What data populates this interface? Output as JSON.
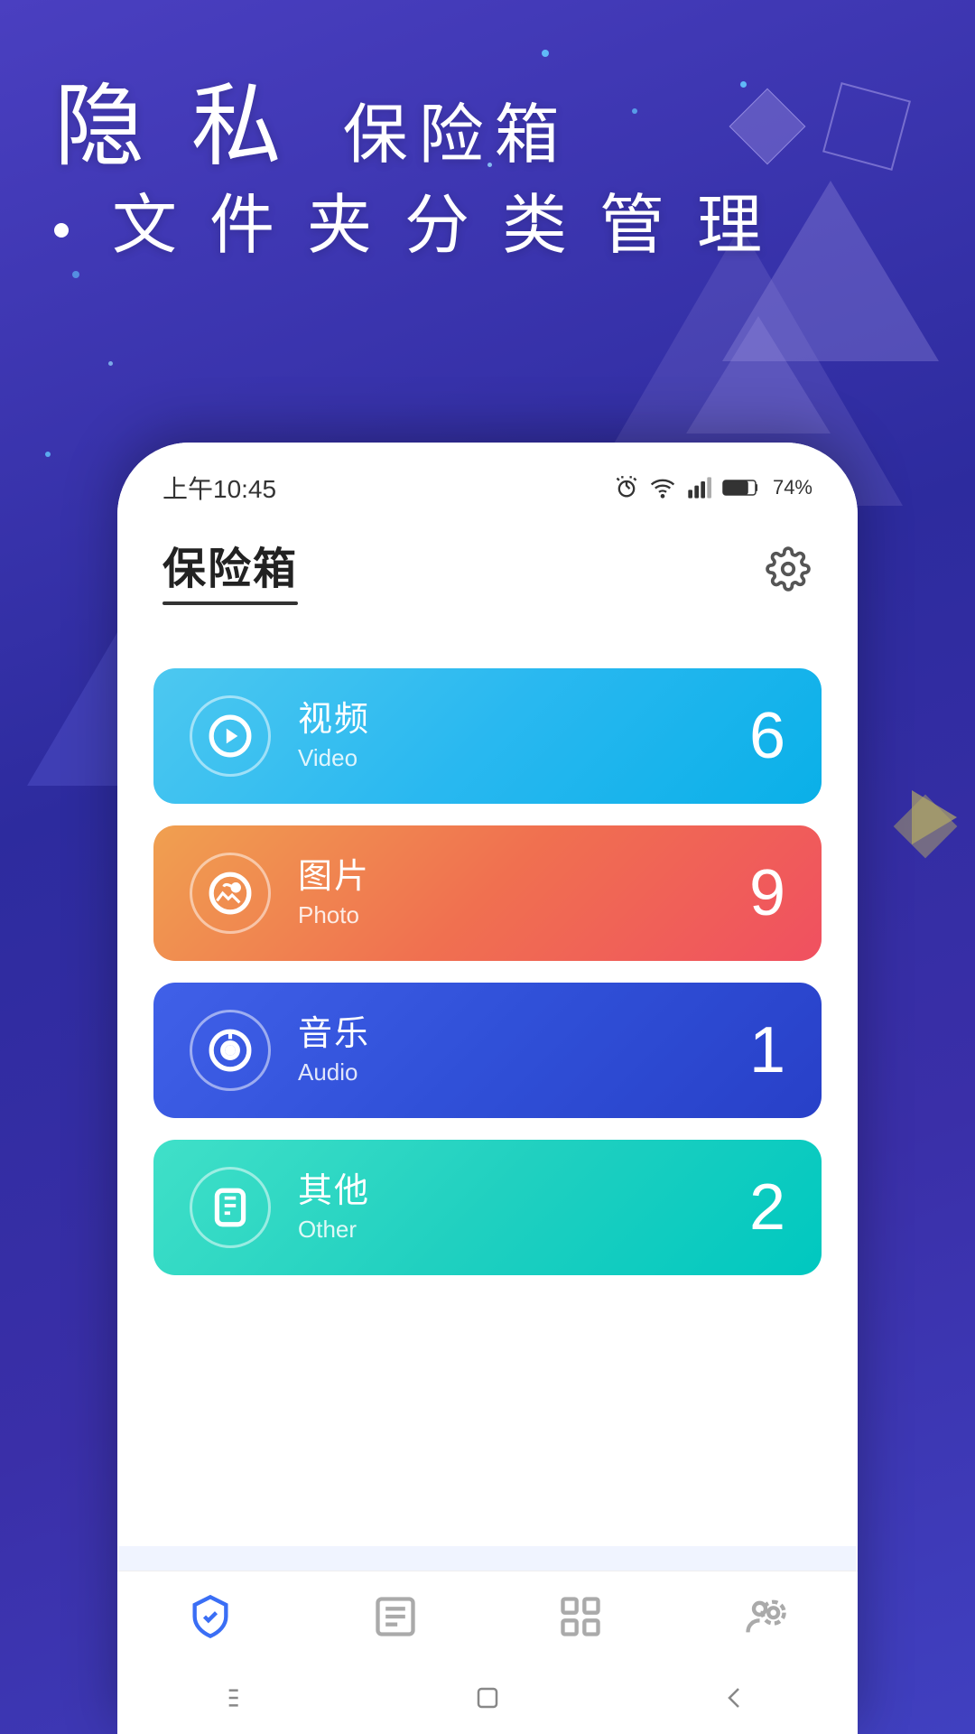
{
  "app": {
    "background_gradient": "linear-gradient(160deg, #4a3fc0, #2d2b9e, #3a2fa8, #4040c0)"
  },
  "header": {
    "title_zh": "隐 私",
    "title_suffix": "保险箱",
    "subtitle": "文 件 夹 分 类 管 理"
  },
  "status_bar": {
    "time": "上午10:45",
    "battery_percent": "74%"
  },
  "app_screen": {
    "title": "保险箱",
    "settings_label": "设置"
  },
  "categories": [
    {
      "id": "video",
      "name_zh": "视频",
      "name_en": "Video",
      "count": "6",
      "color_class": "card-video"
    },
    {
      "id": "photo",
      "name_zh": "图片",
      "name_en": "Photo",
      "count": "9",
      "color_class": "card-photo"
    },
    {
      "id": "audio",
      "name_zh": "音乐",
      "name_en": "Audio",
      "count": "1",
      "color_class": "card-audio"
    },
    {
      "id": "other",
      "name_zh": "其他",
      "name_en": "Other",
      "count": "2",
      "color_class": "card-other"
    }
  ],
  "bottom_nav": [
    {
      "id": "safe",
      "icon": "shield",
      "active": true
    },
    {
      "id": "list",
      "icon": "list",
      "active": false
    },
    {
      "id": "apps",
      "icon": "apps",
      "active": false
    },
    {
      "id": "users",
      "icon": "users",
      "active": false
    }
  ],
  "system_nav": {
    "menu_label": "menu",
    "home_label": "home",
    "back_label": "back"
  }
}
